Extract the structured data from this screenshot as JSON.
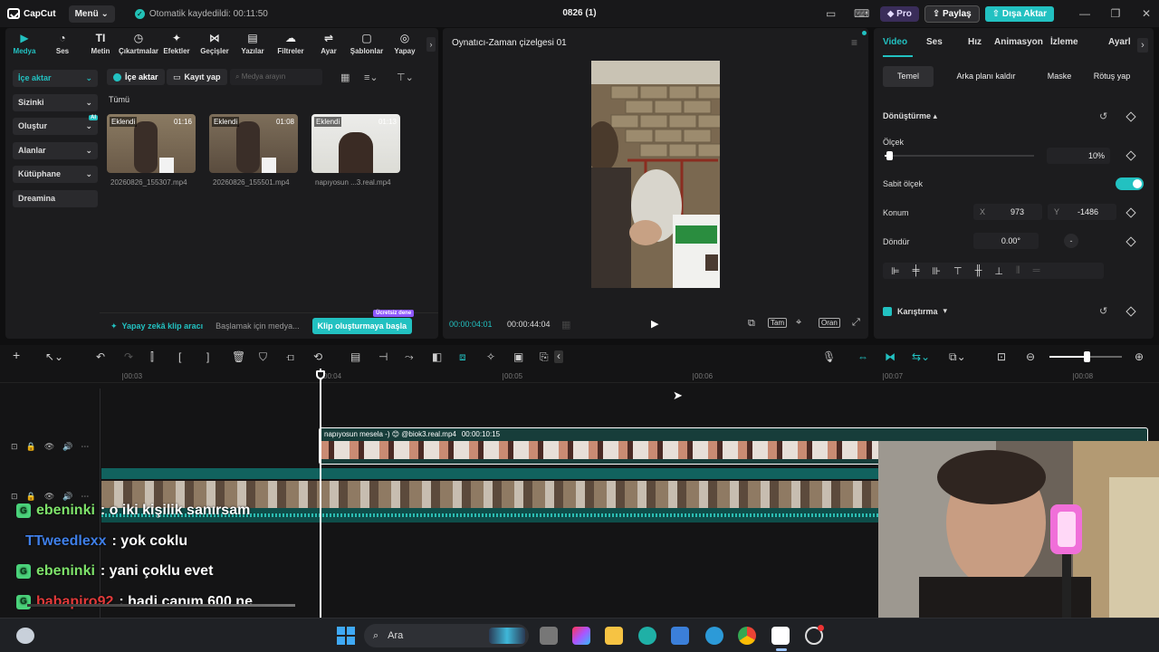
{
  "app": {
    "logo": "CapCut",
    "menu_label": "Menü",
    "autosave_text": "Otomatik kaydedildi: 00:11:50",
    "title": "0826 (1)",
    "pro_label": "Pro",
    "share_label": "Paylaş",
    "export_label": "Dışa Aktar"
  },
  "media_tabs": [
    {
      "label": "Medya",
      "icon": "media-icon"
    },
    {
      "label": "Ses",
      "icon": "audio-icon"
    },
    {
      "label": "Metin",
      "icon": "text-icon"
    },
    {
      "label": "Çıkartmalar",
      "icon": "sticker-icon"
    },
    {
      "label": "Efektler",
      "icon": "effects-icon"
    },
    {
      "label": "Geçişler",
      "icon": "transitions-icon"
    },
    {
      "label": "Yazılar",
      "icon": "captions-icon"
    },
    {
      "label": "Filtreler",
      "icon": "filters-icon"
    },
    {
      "label": "Ayar",
      "icon": "adjust-icon"
    },
    {
      "label": "Şablonlar",
      "icon": "templates-icon"
    },
    {
      "label": "Yapay",
      "icon": "ai-icon"
    }
  ],
  "sidebar": [
    {
      "label": "İçe aktar"
    },
    {
      "label": "Sizinki"
    },
    {
      "label": "Oluştur",
      "badge": "AI"
    },
    {
      "label": "Alanlar"
    },
    {
      "label": "Kütüphane"
    },
    {
      "label": "Dreamina"
    }
  ],
  "media_toolbar": {
    "import_label": "İçe aktar",
    "record_label": "Kayıt yap",
    "search_placeholder": "Medya arayın"
  },
  "media_section": "Tümü",
  "media_items": [
    {
      "badge": "Eklendi",
      "duration": "01:16",
      "name": "20260826_155307.mp4"
    },
    {
      "badge": "Eklendi",
      "duration": "01:08",
      "name": "20260826_155501.mp4"
    },
    {
      "badge": "Eklendi",
      "duration": "01:13",
      "name": "napıyosun ...3.real.mp4"
    }
  ],
  "media_footer": {
    "ai_label": "Yapay zekâ klip aracı",
    "hint": "Başlamak için medya...",
    "button": "Klip oluşturmaya başla",
    "free_tag": "Ücretsiz dene"
  },
  "player": {
    "title": "Oynatıcı-Zaman çizelgesi 01",
    "current_time": "00:00:04:01",
    "total_time": "00:00:44:04",
    "full_label": "Tam",
    "ratio_label": "Oran"
  },
  "props": {
    "tabs": [
      "Video",
      "Ses",
      "Hız",
      "Animasyon",
      "İzleme",
      "Ayarl"
    ],
    "subtabs": [
      "Temel",
      "Arka planı kaldır",
      "Maske",
      "Rötuş yap"
    ],
    "transform_label": "Dönüştürme",
    "scale_label": "Ölçek",
    "scale_value": "10%",
    "scale_fraction": 0.02,
    "uniform_scale_label": "Sabit ölçek",
    "position_label": "Konum",
    "x_label": "X",
    "x_value": "973",
    "y_label": "Y",
    "y_value": "-1486",
    "rotate_label": "Döndür",
    "rotate_value": "0.00°",
    "blend_label": "Karıştırma"
  },
  "timeline": {
    "ruler": [
      "00:03",
      "00:04",
      "00:05",
      "00:06",
      "00:07",
      "00:08"
    ],
    "overlay_clip_name": "napıyosun mesela -) 😊 @biok3.real.mp4",
    "overlay_clip_duration": "00:00:10:15"
  },
  "chat": [
    {
      "user": "ebeninki",
      "text": ": o iki kişilik sanırsam",
      "color": "#7ee26a",
      "badge": true
    },
    {
      "user": "TTweedlexx",
      "text": ": yok coklu",
      "color": "#3f7fe8",
      "badge": false
    },
    {
      "user": "ebeninki",
      "text": ": yani çoklu evet",
      "color": "#7ee26a",
      "badge": true
    },
    {
      "user": "babapiro92",
      "text": ": hadi canım 600 ne",
      "color": "#e23a3a",
      "badge": true
    }
  ],
  "taskbar": {
    "search_label": "Ara"
  },
  "colors": {
    "accent": "#22c1c1",
    "panel": "#1c1c1e"
  }
}
